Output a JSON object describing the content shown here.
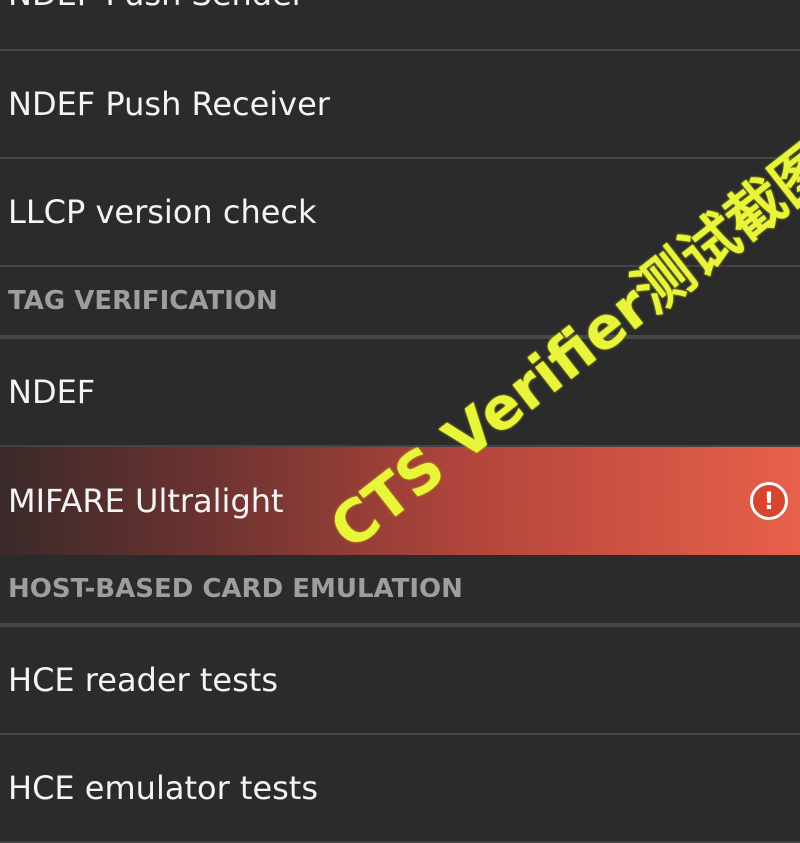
{
  "rows": {
    "ndef_push_sender": "NDEF Push Sender",
    "ndef_push_receiver": "NDEF Push Receiver",
    "llcp_version_check": "LLCP version check",
    "ndef": "NDEF",
    "mifare_ultralight": "MIFARE Ultralight",
    "hce_reader_tests": "HCE reader tests",
    "hce_emulator_tests": "HCE emulator tests"
  },
  "headers": {
    "tag_verification": "TAG VERIFICATION",
    "host_based_card_emulation": "HOST-BASED CARD EMULATION"
  },
  "status": {
    "mifare_ultralight": "!"
  },
  "watermark": "CTS Verifier测试截图",
  "colors": {
    "background": "#2b2b2b",
    "fail_accent": "#e8604a",
    "watermark": "#e9f53a"
  }
}
